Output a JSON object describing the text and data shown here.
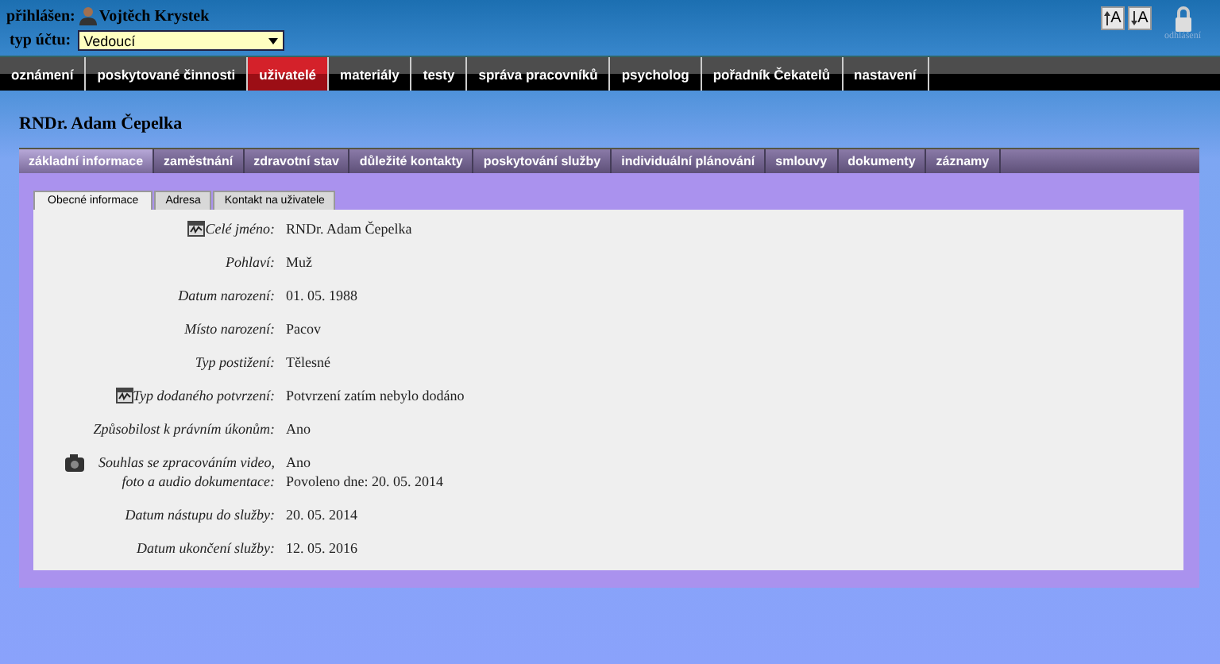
{
  "user": {
    "prefix": "přihlášen:",
    "name": "Vojtěch Krystek"
  },
  "account_type": {
    "label": "typ účtu:",
    "value": "Vedoucí"
  },
  "font_buttons": [
    {
      "label": "A",
      "kind": "increase"
    },
    {
      "label": "A",
      "kind": "decrease"
    }
  ],
  "logout": {
    "label": "odhlášení"
  },
  "nav": [
    {
      "label": "oznámení",
      "selected": false
    },
    {
      "label": "poskytované činnosti",
      "selected": false
    },
    {
      "label": "uživatelé",
      "selected": true
    },
    {
      "label": "materiály",
      "selected": false
    },
    {
      "label": "testy",
      "selected": false
    },
    {
      "label": "správa pracovníků",
      "selected": false
    },
    {
      "label": "psycholog",
      "selected": false
    },
    {
      "label": "pořadník Čekatelů",
      "selected": false
    },
    {
      "label": "nastavení",
      "selected": false
    }
  ],
  "page_title": "RNDr. Adam Čepelka",
  "tabs": [
    {
      "label": "základní informace",
      "selected": true
    },
    {
      "label": "zaměstnání",
      "selected": false
    },
    {
      "label": "zdravotní stav",
      "selected": false
    },
    {
      "label": "důležité kontakty",
      "selected": false
    },
    {
      "label": "poskytování služby",
      "selected": false
    },
    {
      "label": "individuální plánování",
      "selected": false
    },
    {
      "label": "smlouvy",
      "selected": false
    },
    {
      "label": "dokumenty",
      "selected": false
    },
    {
      "label": "záznamy",
      "selected": false
    }
  ],
  "subtabs": [
    {
      "label": "Obecné informace",
      "selected": true
    },
    {
      "label": "Adresa",
      "selected": false
    },
    {
      "label": "Kontakt na uživatele",
      "selected": false
    }
  ],
  "fields": [
    {
      "label": "Celé jméno:",
      "values": [
        "RNDr. Adam Čepelka"
      ],
      "kind": "signed"
    },
    {
      "label": "Pohlaví:",
      "values": [
        "Muž"
      ]
    },
    {
      "label": "Datum narození:",
      "values": [
        "01. 05. 1988"
      ]
    },
    {
      "label": "Místo narození:",
      "values": [
        "Pacov"
      ]
    },
    {
      "label": "Typ postižení:",
      "values": [
        "Tělesné"
      ]
    },
    {
      "label": "Typ dodaného potvrzení:",
      "values": [
        "Potvrzení zatím nebylo dodáno"
      ],
      "kind": "signed"
    },
    {
      "label": "Způsobilost k právním úkonům:",
      "values": [
        "Ano"
      ]
    },
    {
      "label": "Souhlas se zpracováním video, foto a audio dokumentace:",
      "values": [
        "Ano",
        "Povoleno dne: 20. 05. 2014"
      ],
      "kind": "consent"
    },
    {
      "label": "Datum nástupu do služby:",
      "values": [
        "20. 05. 2014"
      ]
    },
    {
      "label": "Datum ukončení služby:",
      "values": [
        "12. 05. 2016"
      ]
    }
  ]
}
